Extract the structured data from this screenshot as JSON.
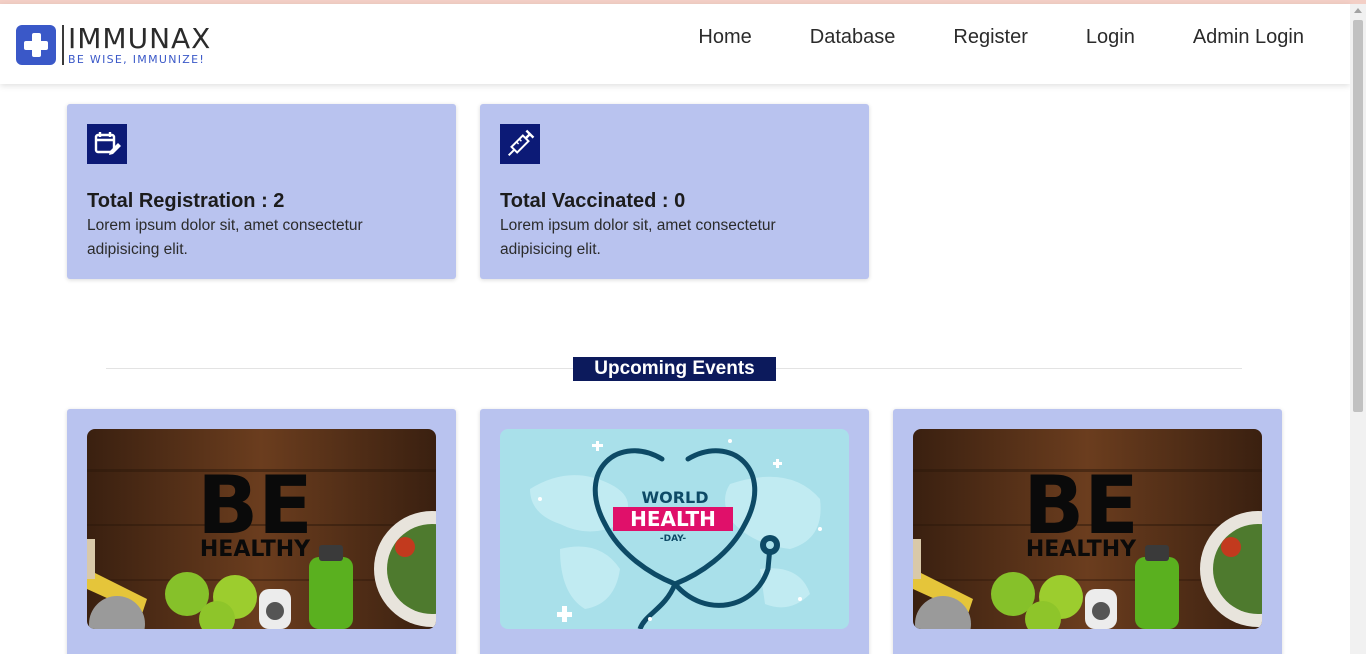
{
  "brand": {
    "name": "IMMUNAX",
    "tagline": "BE WISE, IMMUNIZE!",
    "accent": "#3a58c8"
  },
  "nav": {
    "links": [
      "Home",
      "Database",
      "Register",
      "Login",
      "Admin Login"
    ]
  },
  "stats": [
    {
      "icon": "calendar-edit-icon",
      "title": "Total Registration :  2",
      "desc": "Lorem ipsum dolor sit, amet consectetur adipisicing elit."
    },
    {
      "icon": "syringe-icon",
      "title": "Total Vaccinated :  0",
      "desc": "Lorem ipsum dolor sit, amet consectetur adipisicing elit."
    }
  ],
  "events": {
    "heading": "Upcoming Events",
    "items": [
      {
        "image": "be-healthy-poster",
        "text_line1": "BE",
        "text_line2": "HEALTHY"
      },
      {
        "image": "world-health-day-poster",
        "text_line1": "WORLD",
        "text_line2": "HEALTH",
        "text_line3": "-DAY-"
      },
      {
        "image": "be-healthy-poster",
        "text_line1": "BE",
        "text_line2": "HEALTHY"
      }
    ]
  },
  "colors": {
    "card_bg": "#b9c3ef",
    "icon_bg": "#0c1a76",
    "heading_bg": "#0c1a5c"
  }
}
